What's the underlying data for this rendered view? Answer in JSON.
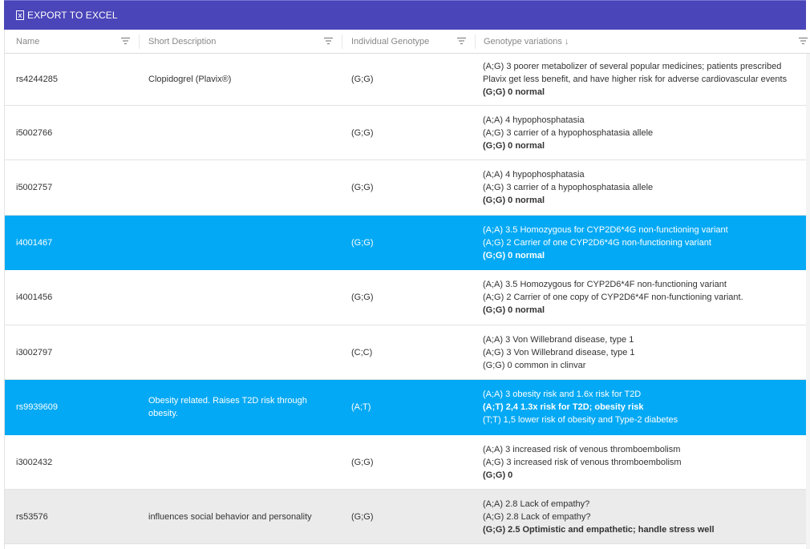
{
  "toolbar": {
    "export_label": "EXPORT TO EXCEL"
  },
  "columns": {
    "name": "Name",
    "desc": "Short Description",
    "geno": "Individual Genotype",
    "vars": "Genotype variations ↓"
  },
  "rows": [
    {
      "name": "rs4244285",
      "desc": "Clopidogrel (Plavix®)",
      "geno": "(G;G)",
      "v1": "(A;G) 3 poorer metabolizer of several popular medicines; patients prescribed",
      "v2": "Plavix get less benefit, and have higher risk for adverse cardiovascular events",
      "v3": "(G;G) 0 normal"
    },
    {
      "name": "i5002766",
      "desc": "",
      "geno": "(G;G)",
      "v1": "(A;A) 4 hypophosphatasia",
      "v2": "(A;G) 3 carrier of a hypophosphatasia allele",
      "v3": "(G;G) 0 normal"
    },
    {
      "name": "i5002757",
      "desc": "",
      "geno": "(G;G)",
      "v1": "(A;A) 4 hypophosphatasia",
      "v2": "(A;G) 3 carrier of a hypophosphatasia allele",
      "v3": "(G;G) 0 normal"
    },
    {
      "name": "i4001467",
      "desc": "",
      "geno": "(G;G)",
      "v1": "(A;A) 3.5 Homozygous for CYP2D6*4G non-functioning variant",
      "v2": "(A;G) 2 Carrier of one CYP2D6*4G non-functioning variant",
      "v3": "(G;G) 0 normal"
    },
    {
      "name": "i4001456",
      "desc": "",
      "geno": "(G;G)",
      "v1": "(A;A) 3.5 Homozygous for CYP2D6*4F non-functioning variant",
      "v2": "(A;G) 2 Carrier of one copy of CYP2D6*4F non-functioning variant.",
      "v3": "(G;G) 0 normal"
    },
    {
      "name": "i3002797",
      "desc": "",
      "geno": "(C;C)",
      "v1": "(A;A) 3 Von Willebrand disease, type 1",
      "v2": "(A;G) 3 Von Willebrand disease, type 1",
      "v3": "(G;G) 0 common in clinvar"
    },
    {
      "name": "rs9939609",
      "desc": "Obesity related. Raises T2D risk through obesity.",
      "geno": "(A;T)",
      "v1": "(A;A) 3 obesity risk and 1.6x risk for T2D",
      "v2": "(A;T) 2,4 1.3x risk for T2D; obesity risk",
      "v3": "(T;T) 1,5 lower risk of obesity and Type-2 diabetes"
    },
    {
      "name": "i3002432",
      "desc": "",
      "geno": "(G;G)",
      "v1": "(A;A) 3 increased risk of venous thromboembolism",
      "v2": "(A;G) 3 increased risk of venous thromboembolism",
      "v3": "(G;G) 0"
    },
    {
      "name": "rs53576",
      "desc": "influences social behavior and personality",
      "geno": "(G;G)",
      "v1": "(A;A) 2.8 Lack of empathy?",
      "v2": "(A;G) 2.8 Lack of empathy?",
      "v3": "(G;G) 2.5 Optimistic and empathetic; handle stress well"
    }
  ]
}
